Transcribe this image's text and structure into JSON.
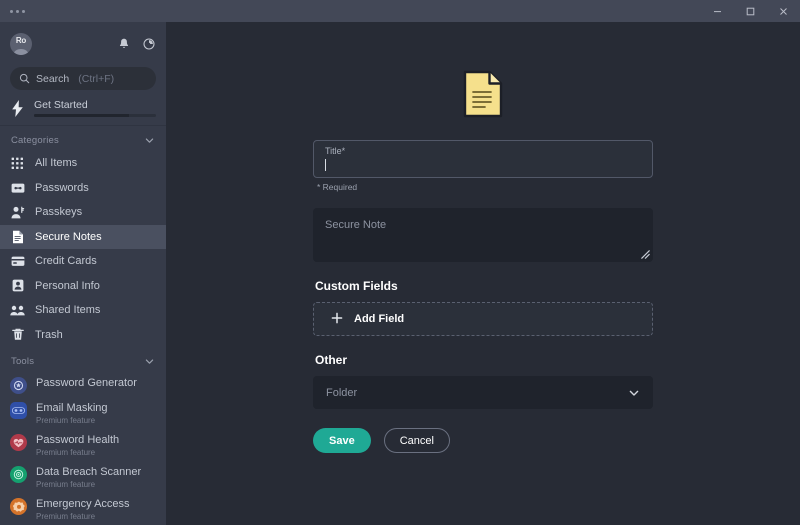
{
  "titlebar": {
    "menu_dots": "...",
    "minimize_label": "Minimize",
    "maximize_label": "Maximize",
    "close_label": "Close"
  },
  "sidebar": {
    "avatar": {
      "initials": "Ro",
      "name": "avatar"
    },
    "notifications_icon": "bell-icon",
    "settings_icon": "gear-icon",
    "search": {
      "placeholder": "Search",
      "label": "Search",
      "shortcut": "(Ctrl+F)"
    },
    "get_started": {
      "label": "Get Started",
      "icon": "lightning-bolt-icon",
      "progress_percent": 78
    },
    "categories": {
      "title": "Categories",
      "chevron": "chevron-down-icon",
      "items": [
        {
          "label": "All Items",
          "icon": "grid-icon",
          "active": false
        },
        {
          "label": "Passwords",
          "icon": "key-card-icon",
          "active": false
        },
        {
          "label": "Passkeys",
          "icon": "passkey-person-icon",
          "active": false
        },
        {
          "label": "Secure Notes",
          "icon": "note-icon",
          "active": true
        },
        {
          "label": "Credit Cards",
          "icon": "credit-card-icon",
          "active": false
        },
        {
          "label": "Personal Info",
          "icon": "id-card-icon",
          "active": false
        },
        {
          "label": "Shared Items",
          "icon": "people-icon",
          "active": false
        },
        {
          "label": "Trash",
          "icon": "trash-icon",
          "active": false
        }
      ]
    },
    "tools": {
      "title": "Tools",
      "chevron": "chevron-down-icon",
      "items": [
        {
          "label": "Password Generator",
          "sub": "",
          "icon": "generator-icon",
          "color": "#3f4f8a"
        },
        {
          "label": "Email Masking",
          "sub": "Premium feature",
          "icon": "mask-icon",
          "color": "#2f4fa8"
        },
        {
          "label": "Password Health",
          "sub": "Premium feature",
          "icon": "heart-pulse-icon",
          "color": "#b03a4a"
        },
        {
          "label": "Data Breach Scanner",
          "sub": "Premium feature",
          "icon": "scanner-icon",
          "color": "#15a06f"
        },
        {
          "label": "Emergency Access",
          "sub": "Premium feature",
          "icon": "emergency-icon",
          "color": "#d4732a"
        }
      ]
    }
  },
  "main": {
    "item_icon": "secure-note-document-icon",
    "title_field": {
      "label": "Title*",
      "value": "",
      "placeholder": "Title*"
    },
    "required_note": "* Required",
    "note_field": {
      "placeholder": "Secure Note",
      "value": ""
    },
    "custom_fields": {
      "heading": "Custom Fields",
      "add_field_label": "Add Field",
      "add_icon": "plus-icon"
    },
    "other": {
      "heading": "Other",
      "folder_select": {
        "value": "Folder",
        "chevron": "chevron-down-icon"
      }
    },
    "actions": {
      "save_label": "Save",
      "cancel_label": "Cancel"
    }
  },
  "colors": {
    "accent": "#1fa995",
    "sidebar_bg": "#363b49",
    "main_bg": "#272b35",
    "titlebar_bg": "#434857",
    "active_item_bg": "#4a5060",
    "note_icon_yellow": "#f5e08c"
  }
}
